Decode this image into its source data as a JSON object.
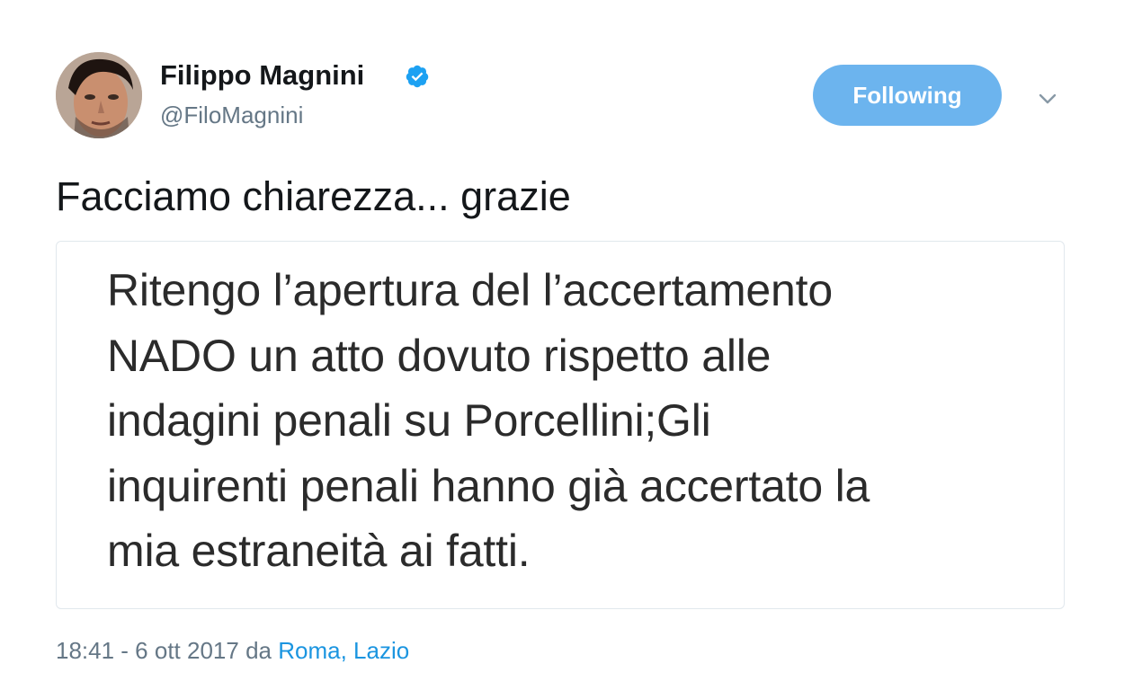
{
  "author": {
    "display_name": "Filippo Magnini",
    "handle": "@FiloMagnini",
    "verified": true,
    "avatar_icon": "profile-photo"
  },
  "actions": {
    "follow_label": "Following",
    "menu_icon": "chevron-down-icon"
  },
  "tweet": {
    "text": "Facciamo chiarezza... grazie",
    "media_text": "Ritengo l’apertura del l’accertamento\nNADO un atto dovuto rispetto alle\nindagini penali su Porcellini;Gli\ninquirenti penali hanno già accertato la\nmia estraneità ai fatti."
  },
  "meta": {
    "timestamp": "18:41 - 6 ott 2017",
    "via": "da",
    "location": "Roma, Lazio"
  },
  "colors": {
    "accent": "#1b95e0",
    "button_bg": "#6cb4ee",
    "verified": "#1da1f2",
    "secondary_text": "#657786"
  }
}
